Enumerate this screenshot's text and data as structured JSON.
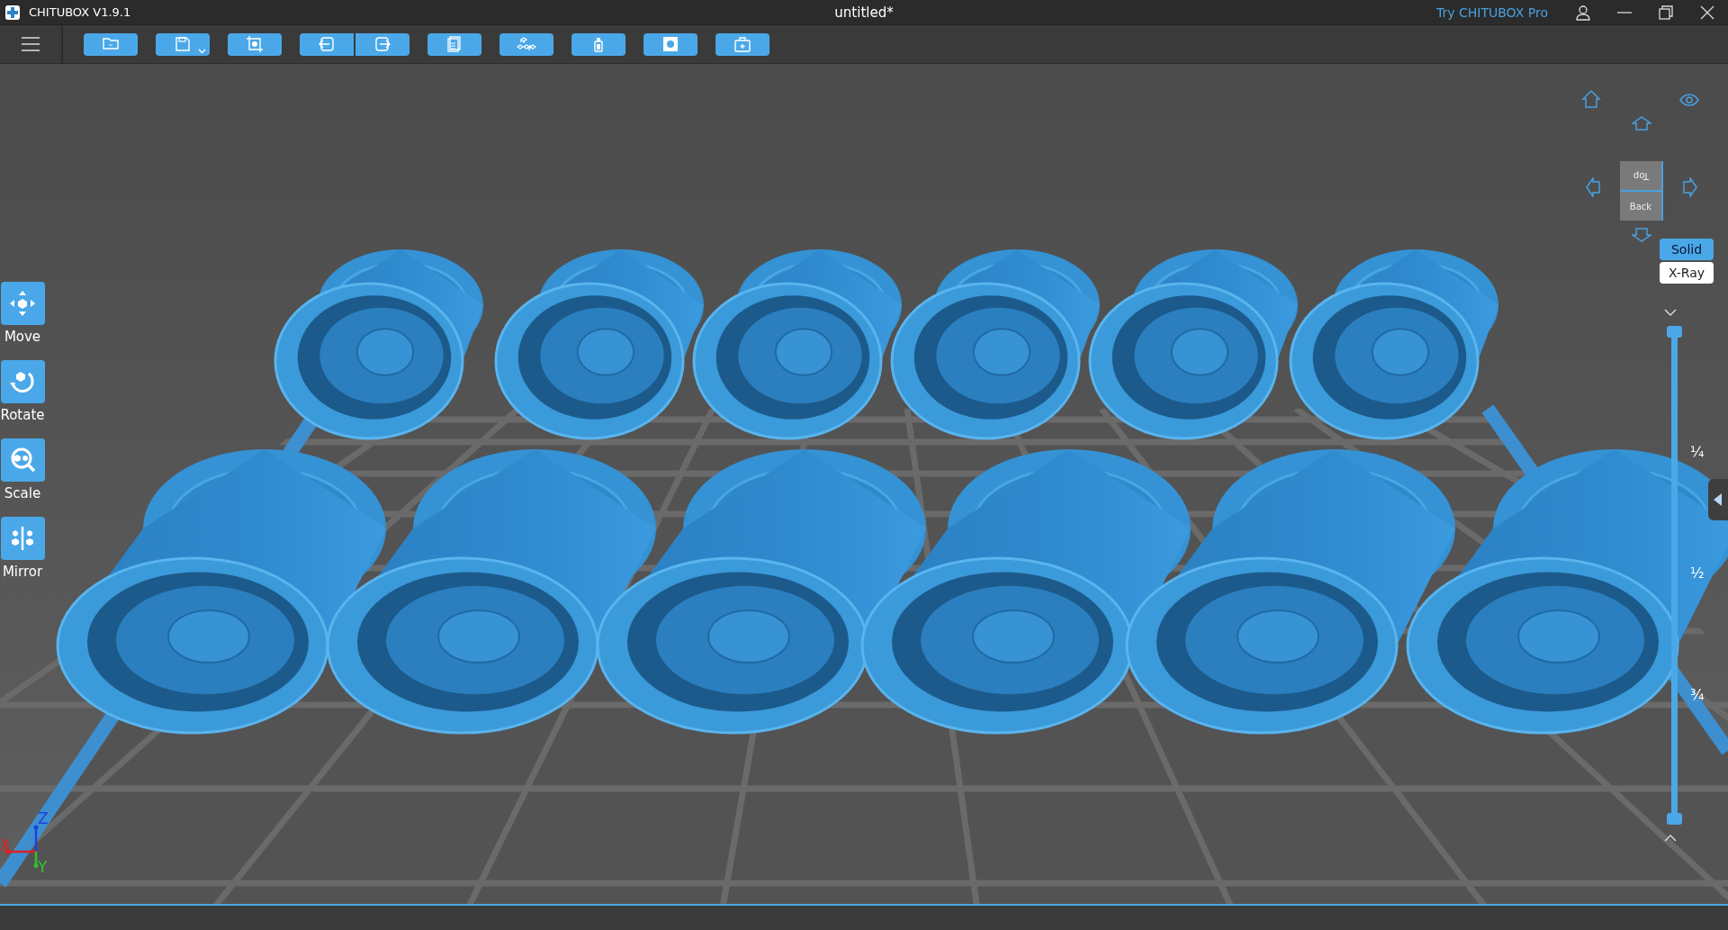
{
  "window": {
    "app_title": "CHITUBOX V1.9.1",
    "document_title": "untitled*",
    "promo_link": "Try CHITUBOX Pro"
  },
  "tools": [
    {
      "kind": "move",
      "label": "Move"
    },
    {
      "kind": "rotate",
      "label": "Rotate"
    },
    {
      "kind": "scale",
      "label": "Scale"
    },
    {
      "kind": "mirror",
      "label": "Mirror"
    }
  ],
  "view_cube": {
    "top_face": "Top",
    "front_face": "Back"
  },
  "display_modes": [
    {
      "label": "Solid",
      "selected": true
    },
    {
      "label": "X-Ray",
      "selected": false
    }
  ],
  "layer_slider": {
    "level": 1,
    "marks": [
      "¼",
      "½",
      "¾"
    ]
  },
  "axes": {
    "x": "X",
    "y": "Y",
    "z": "Z"
  }
}
